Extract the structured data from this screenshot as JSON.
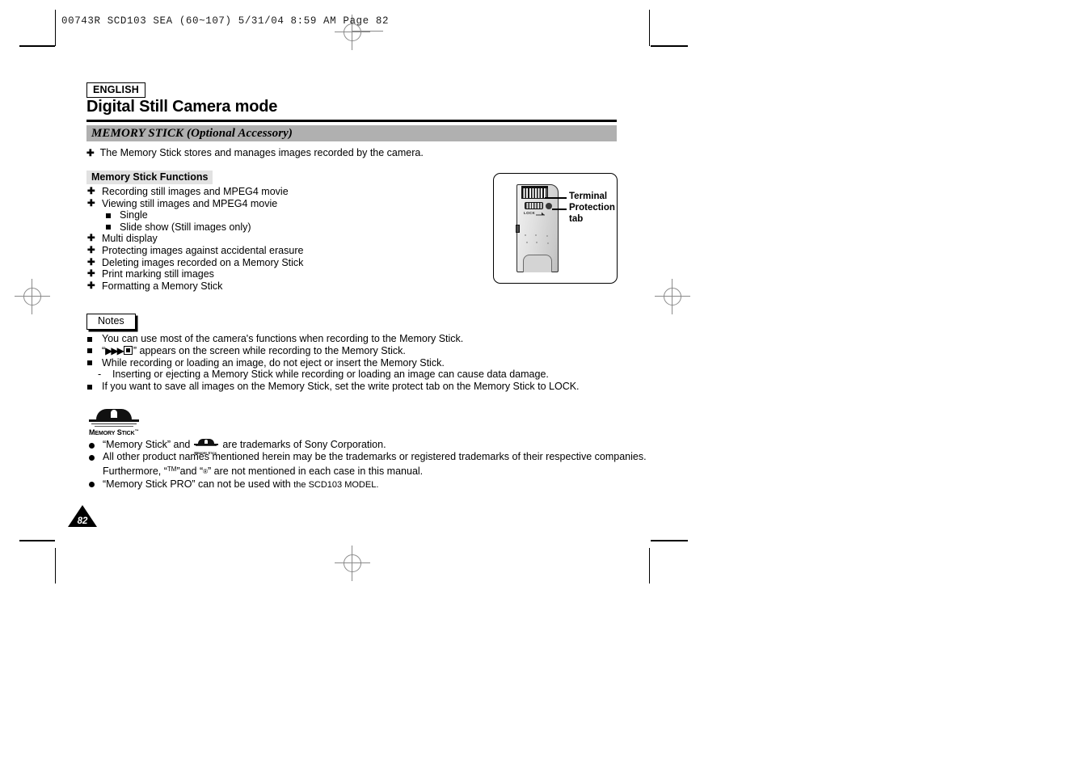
{
  "prepress": {
    "header_line": "00743R SCD103 SEA (60~107)   5/31/04 8:59 AM   Page 82"
  },
  "page": {
    "language_badge": "ENGLISH",
    "title": "Digital Still Camera mode",
    "section_bar": "MEMORY STICK (Optional Accessory)",
    "intro": "The Memory Stick stores and manages images recorded by the camera.",
    "page_number": "82"
  },
  "functions": {
    "heading": "Memory Stick Functions",
    "items": [
      {
        "text": "Recording still images and MPEG4 movie",
        "level": 1
      },
      {
        "text": "Viewing still images and MPEG4 movie",
        "level": 1
      },
      {
        "text": "Single",
        "level": 2
      },
      {
        "text": "Slide show (Still images only)",
        "level": 2
      },
      {
        "text": "Multi display",
        "level": 1
      },
      {
        "text": "Protecting images against accidental erasure",
        "level": 1
      },
      {
        "text": "Deleting images recorded on a Memory Stick",
        "level": 1
      },
      {
        "text": "Print marking still images",
        "level": 1
      },
      {
        "text": "Formatting a Memory Stick",
        "level": 1
      }
    ]
  },
  "illustration": {
    "label_terminal": "Terminal",
    "label_protection_1": "Protection",
    "label_protection_2": "tab",
    "card_lock_text": "LOCK"
  },
  "notes": {
    "tab_label": "Notes",
    "items": [
      "You can use most of the camera's functions when recording to the Memory Stick.",
      "“",
      "While recording or loading an image, do not eject or insert the Memory Stick.",
      "Inserting or ejecting a Memory Stick while recording or loading an image can cause data damage.",
      "If you want to save all images on the Memory Stick, set the write protect tab on the Memory Stick to LOCK."
    ],
    "item2_prefix": "“",
    "item2_triangles": "▶▶▶",
    "item2_suffix": "” appears on the screen while recording to the Memory Stick.",
    "dash_mark": "-"
  },
  "trademark": {
    "logo_wordmark_memory": "M",
    "logo_wordmark_memory_rest": "EMORY",
    "logo_wordmark_stick": "S",
    "logo_wordmark_stick_rest": "TICK",
    "logo_tm": "™",
    "line1_a": "“Memory Stick” and",
    "line1_b": "are trademarks of Sony Corporation.",
    "line2_a": "All other product names mentioned herein may be the trademarks or registered trademarks of their respective companies.",
    "line2_b_pre": "Furthermore, “",
    "line2_b_tm": "TM",
    "line2_b_mid": "”and “",
    "line2_b_r": "®",
    "line2_b_post": "” are not mentioned in each case in this manual.",
    "line3_a": "“Memory Stick PRO” can not be used with",
    "line3_b": "the SCD103 MODEL."
  }
}
